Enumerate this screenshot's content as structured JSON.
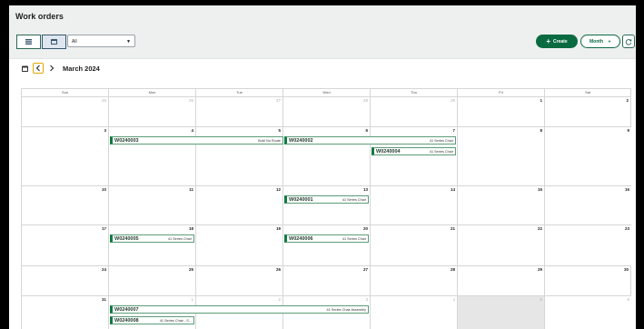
{
  "header": {
    "title": "Work orders"
  },
  "toolbar": {
    "list_view_icon": "list-icon",
    "calendar_view_icon": "calendar-icon",
    "filter_value": "All",
    "create_label": "Create",
    "month_label": "Month",
    "refresh_icon": "refresh-icon"
  },
  "nav": {
    "title": "March 2024"
  },
  "calendar": {
    "days_of_week": [
      "Sun",
      "Mon",
      "Tue",
      "Wed",
      "Thu",
      "Fri",
      "Sat"
    ],
    "weeks": [
      {
        "days": [
          [
            "25",
            true
          ],
          [
            "26",
            true
          ],
          [
            "27",
            true
          ],
          [
            "28",
            true
          ],
          [
            "29",
            true
          ],
          [
            "1",
            false
          ],
          [
            "2",
            false
          ]
        ]
      },
      {
        "days": [
          [
            "3",
            false
          ],
          [
            "4",
            false
          ],
          [
            "5",
            false
          ],
          [
            "6",
            false
          ],
          [
            "7",
            false
          ],
          [
            "8",
            false
          ],
          [
            "9",
            false
          ]
        ]
      },
      {
        "days": [
          [
            "10",
            false
          ],
          [
            "11",
            false
          ],
          [
            "12",
            false
          ],
          [
            "13",
            false
          ],
          [
            "14",
            false
          ],
          [
            "15",
            false
          ],
          [
            "16",
            false
          ]
        ]
      },
      {
        "days": [
          [
            "17",
            false
          ],
          [
            "18",
            false
          ],
          [
            "19",
            false
          ],
          [
            "20",
            false
          ],
          [
            "21",
            false
          ],
          [
            "22",
            false
          ],
          [
            "23",
            false
          ]
        ]
      },
      {
        "days": [
          [
            "24",
            false
          ],
          [
            "25",
            false
          ],
          [
            "26",
            false
          ],
          [
            "27",
            false
          ],
          [
            "28",
            false
          ],
          [
            "29",
            false
          ],
          [
            "30",
            false
          ]
        ]
      },
      {
        "days": [
          [
            "31",
            false
          ],
          [
            "1",
            true
          ],
          [
            "2",
            true
          ],
          [
            "3",
            true
          ],
          [
            "4",
            true
          ],
          [
            "5",
            true
          ],
          [
            "6",
            true
          ]
        ]
      }
    ],
    "events": [
      {
        "id": "W0240003",
        "desc": "BoM No Route"
      },
      {
        "id": "W0240002",
        "desc": "41 Series Chair"
      },
      {
        "id": "W0240004",
        "desc": "41 Series Chair"
      },
      {
        "id": "W0240001",
        "desc": "41 Series Chair"
      },
      {
        "id": "W0240005",
        "desc": "41 Series Chair"
      },
      {
        "id": "W0240006",
        "desc": "41 Series Chair"
      },
      {
        "id": "W0240007",
        "desc": "41 Series Chair Assembly"
      },
      {
        "id": "W0240008",
        "desc": "41 Series Chair - S..."
      }
    ]
  }
}
